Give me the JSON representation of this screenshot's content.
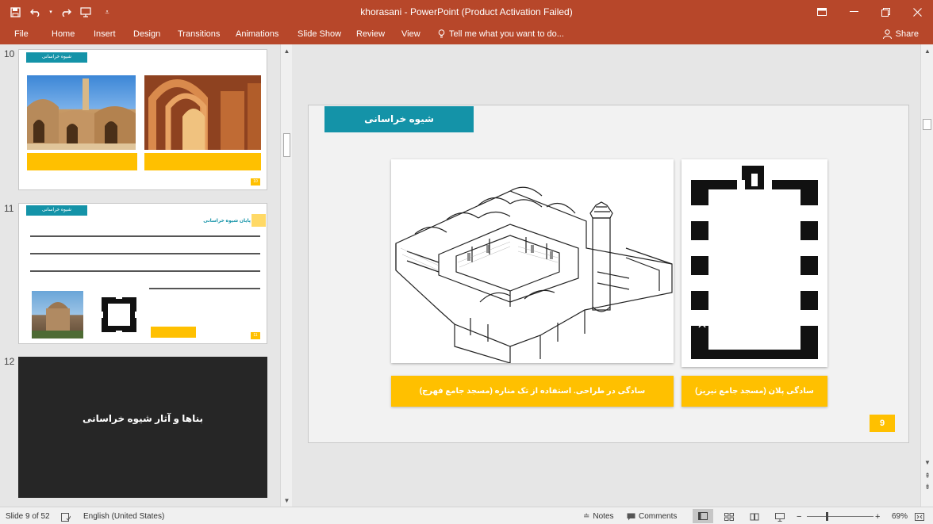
{
  "window": {
    "title": "khorasani - PowerPoint (Product Activation Failed)",
    "controls": [
      "ribbon-display-icon",
      "minimize-icon",
      "restore-icon",
      "close-icon"
    ]
  },
  "quick_access": [
    "save-icon",
    "undo-icon",
    "redo-icon",
    "start-from-beginning-icon",
    "customize-icon"
  ],
  "ribbon": {
    "tabs": [
      "File",
      "Home",
      "Insert",
      "Design",
      "Transitions",
      "Animations",
      "Slide Show",
      "Review",
      "View"
    ],
    "tell_me": "Tell me what you want to do...",
    "share": "Share"
  },
  "thumbnails": [
    {
      "number": "10",
      "banner": "شیوه خراسانی",
      "captions": [
        "",
        ""
      ],
      "page": "10"
    },
    {
      "number": "11",
      "banner": "شیوه خراسانی",
      "heading": "پایان شیوه خراسانی",
      "caption": "",
      "page": "11"
    },
    {
      "number": "12",
      "title": "بناها و آثار شیوه خراسانی"
    }
  ],
  "slide": {
    "banner": "شیوه خراسانی",
    "captions": [
      "سادگی در طراحی. استفاده از تک مناره (مسجد جامع فهرج)",
      "سادگی پلان (مسجد جامع نیریز)"
    ],
    "page": "9"
  },
  "status": {
    "slide_counter": "Slide 9 of 52",
    "language": "English (United States)",
    "notes": "Notes",
    "comments": "Comments",
    "zoom": "69%",
    "zoom_level": 0.69
  },
  "colors": {
    "accent": "#b7472a",
    "banner": "#1493a8",
    "caption": "#ffc000"
  }
}
